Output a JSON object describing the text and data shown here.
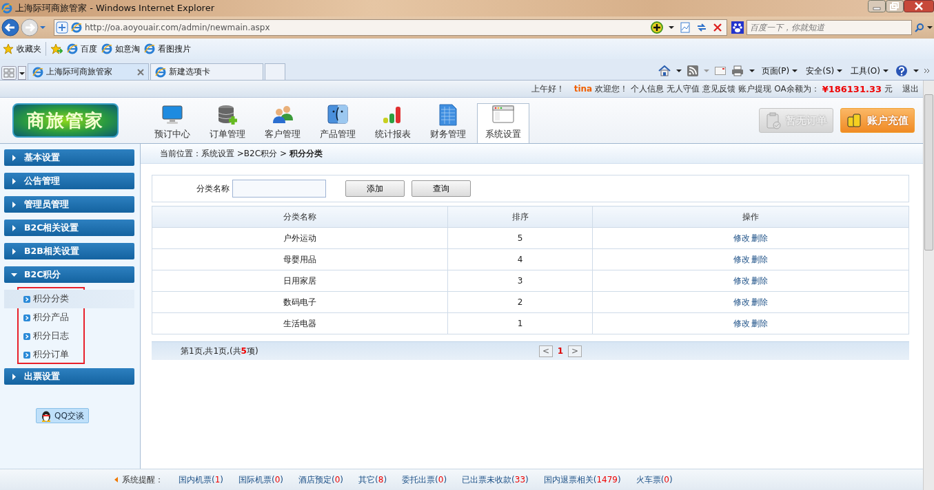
{
  "window": {
    "title": "上海际珂商旅管家 - Windows Internet Explorer"
  },
  "address_bar": {
    "url": "http://oa.aoyouair.com/admin/newmain.aspx"
  },
  "search_box": {
    "placeholder": "百度一下，你就知道"
  },
  "favorites_bar": {
    "label": "收藏夹",
    "links": [
      "百度",
      "如意淘",
      "看图搜片"
    ]
  },
  "tabs": [
    {
      "label": "上海际珂商旅管家",
      "selected": true
    },
    {
      "label": "新建选项卡",
      "selected": false
    }
  ],
  "command_bar": {
    "menus": [
      "页面(P)",
      "安全(S)",
      "工具(O)"
    ]
  },
  "user_bar": {
    "greeting": "上午好！",
    "user": "tina",
    "welcome": "欢迎您！",
    "links": [
      "个人信息",
      "无人守值",
      "意见反馈",
      "账户提现"
    ],
    "balance_label": "OA余额为：",
    "balance": "¥186131.33",
    "unit": "元",
    "logout": "退出"
  },
  "logo": "商旅管家",
  "nav": [
    {
      "label": "预订中心",
      "kind": "monitor",
      "selected": false
    },
    {
      "label": "订单管理",
      "kind": "database",
      "selected": false
    },
    {
      "label": "客户管理",
      "kind": "users",
      "selected": false
    },
    {
      "label": "产品管理",
      "kind": "finder",
      "selected": false
    },
    {
      "label": "统计报表",
      "kind": "bars",
      "selected": false
    },
    {
      "label": "财务管理",
      "kind": "sheet",
      "selected": false
    },
    {
      "label": "系统设置",
      "kind": "window",
      "selected": true
    }
  ],
  "header_buttons": [
    {
      "label": "暂无订单",
      "kind": "clipboard",
      "disabled": true
    },
    {
      "label": "账户充值",
      "kind": "coins",
      "disabled": false
    }
  ],
  "sidebar": {
    "groups": [
      {
        "label": "基本设置",
        "expanded": false
      },
      {
        "label": "公告管理",
        "expanded": false
      },
      {
        "label": "管理员管理",
        "expanded": false
      },
      {
        "label": "B2C相关设置",
        "expanded": false
      },
      {
        "label": "B2B相关设置",
        "expanded": false
      },
      {
        "label": "B2C积分",
        "expanded": true,
        "children": [
          {
            "label": "积分分类",
            "selected": true
          },
          {
            "label": "积分产品",
            "selected": false
          },
          {
            "label": "积分日志",
            "selected": false
          },
          {
            "label": "积分订单",
            "selected": false
          }
        ]
      },
      {
        "label": "出票设置",
        "expanded": false
      }
    ],
    "chat_button": "QQ交谈"
  },
  "breadcrumb": "当前位置：系统设置 >B2C积分 > **积分分类**",
  "filter": {
    "label": "分类名称",
    "buttons": [
      "添加",
      "查询"
    ]
  },
  "table": {
    "columns": [
      "分类名称",
      "排序",
      "操作"
    ],
    "rows": [
      {
        "name": "户外运动",
        "order": "5",
        "actions": [
          "修改",
          "删除"
        ]
      },
      {
        "name": "母婴用品",
        "order": "4",
        "actions": [
          "修改",
          "删除"
        ]
      },
      {
        "name": "日用家居",
        "order": "3",
        "actions": [
          "修改",
          "删除"
        ]
      },
      {
        "name": "数码电子",
        "order": "2",
        "actions": [
          "修改",
          "删除"
        ]
      },
      {
        "name": "生活电器",
        "order": "1",
        "actions": [
          "修改",
          "删除"
        ]
      }
    ]
  },
  "pager": {
    "summary": "第1页,共1页,(共**5**项)",
    "prev": "<",
    "pages": [
      {
        "label": "1",
        "selected": true
      }
    ],
    "next": ">"
  },
  "status_bar": {
    "label": "系统提醒：",
    "items": [
      "国内机票(**1**)",
      "国际机票(**0**)",
      "酒店预定(**0**)",
      "其它(**8**)",
      "委托出票(**0**)",
      "已出票未收款(**33**)",
      "国内退票相关(**1479**)",
      "火车票(**0**)"
    ]
  }
}
